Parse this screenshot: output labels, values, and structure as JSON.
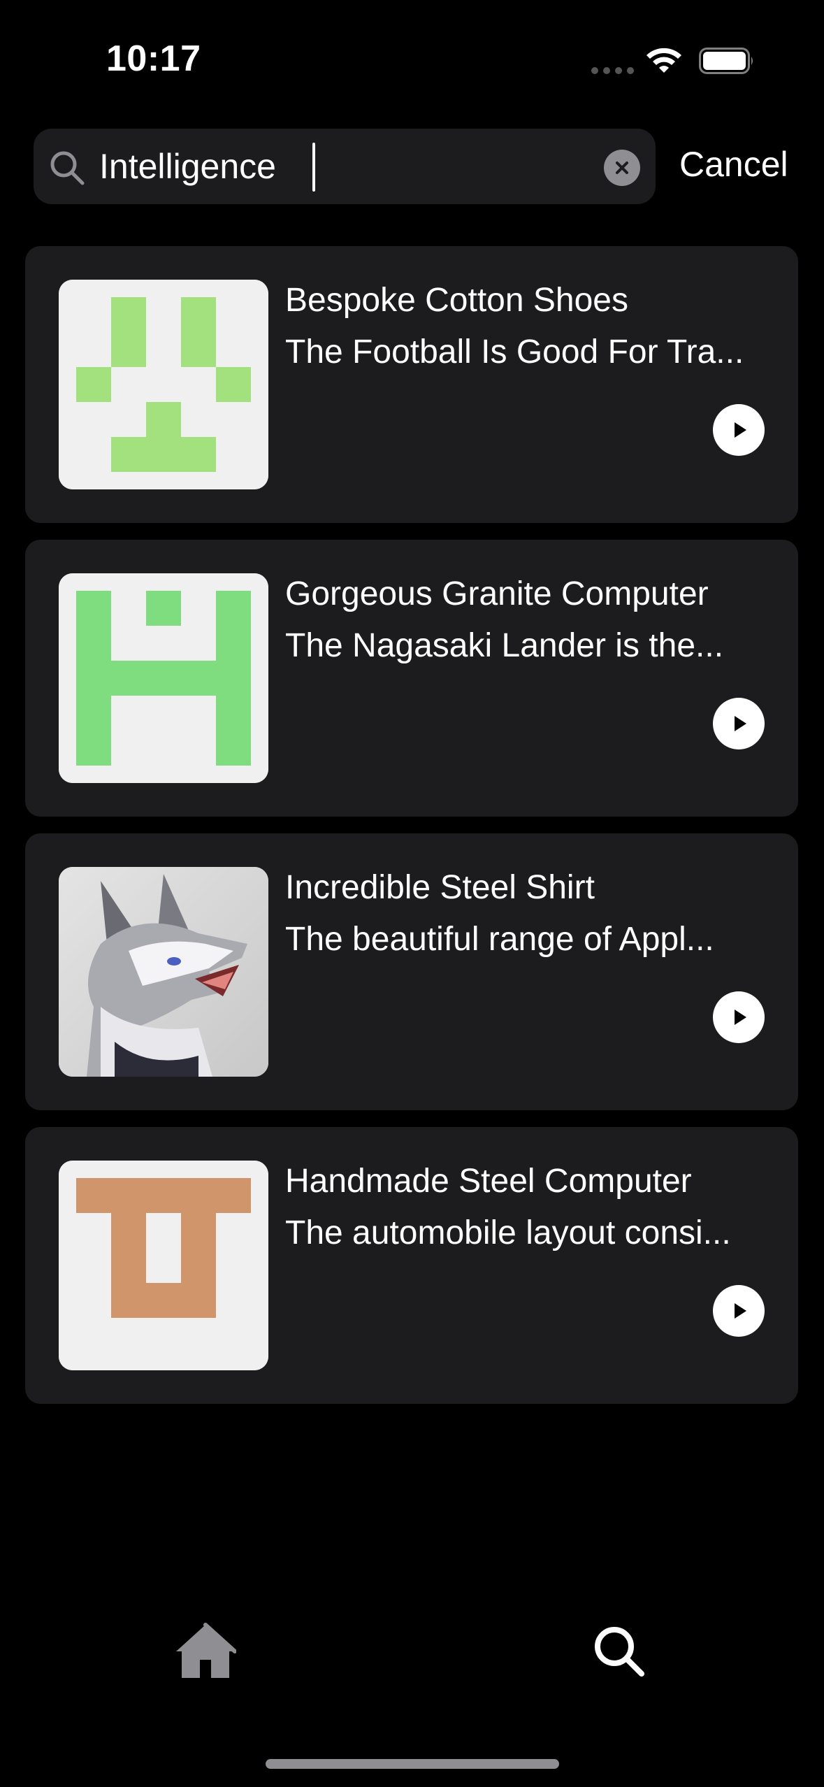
{
  "status_bar": {
    "time": "10:17"
  },
  "search": {
    "value": "Intelligence",
    "cancel_label": "Cancel"
  },
  "results": [
    {
      "title": "Bespoke Cotton Shoes",
      "subtitle": "The Football Is Good For Tra...",
      "thumbnail": "green-pixel-avatar",
      "color": "#a3e07e"
    },
    {
      "title": "Gorgeous Granite Computer",
      "subtitle": "The Nagasaki Lander is the...",
      "thumbnail": "green-pixel-avatar",
      "color": "#7fdc7f"
    },
    {
      "title": "Incredible Steel Shirt",
      "subtitle": "The beautiful range of Appl...",
      "thumbnail": "wolf-illustration",
      "color": "#d3d3d3"
    },
    {
      "title": "Handmade Steel Computer",
      "subtitle": "The automobile layout consi...",
      "thumbnail": "orange-pixel-avatar",
      "color": "#d0956b"
    }
  ],
  "tab_bar": {
    "items": [
      {
        "icon": "home-icon",
        "active": false
      },
      {
        "icon": "search-icon",
        "active": true
      }
    ],
    "inactive_color": "#8e8e93",
    "active_color": "#ffffff"
  }
}
